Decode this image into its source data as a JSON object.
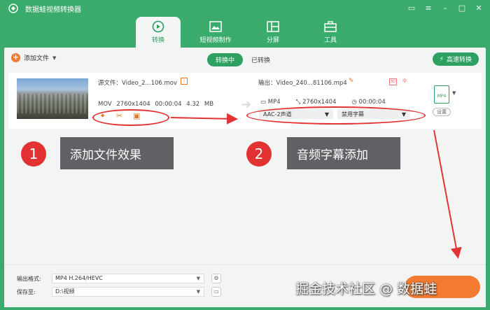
{
  "app": {
    "title": "数据蛙视频转换器",
    "window_controls": [
      "message-icon",
      "menu-icon",
      "minimize-icon",
      "maximize-icon",
      "close-icon"
    ]
  },
  "nav": {
    "tabs": [
      {
        "label": "转换",
        "icon": "convert-icon",
        "active": true
      },
      {
        "label": "短视频制作",
        "icon": "short-video-icon",
        "active": false
      },
      {
        "label": "分屏",
        "icon": "split-screen-icon",
        "active": false
      },
      {
        "label": "工具",
        "icon": "toolbox-icon",
        "active": false
      }
    ]
  },
  "toolbar": {
    "add_file": "添加文件",
    "segment_converting": "转换中",
    "segment_converted": "已转换",
    "fast_convert": "高速转换"
  },
  "file": {
    "source_name": "源文件：Video_2...106.mov",
    "source_meta": "MOV   2760x1404   00:00:04   4.32 MB",
    "output_name": "输出：Video_240...81106.mp4",
    "output_format": "MP4",
    "output_resolution": "2760x1404",
    "output_duration": "00:00:04",
    "audio_select": "AAC-2声道",
    "subtitle_select": "禁用字幕",
    "format_badge": "MP4",
    "settings": "设置"
  },
  "annotations": {
    "n1": "1",
    "label1": "添加文件效果",
    "n2": "2",
    "label2": "音频字幕添加"
  },
  "bottom": {
    "format_label": "输出格式:",
    "format_value": "MP4 H.264/HEVC",
    "save_label": "保存至:",
    "save_value": "D:\\视频"
  },
  "watermark": "掘金技术社区 @ 数据蛙",
  "colors": {
    "brand_green": "#3aab6c",
    "accent_orange": "#f27a31",
    "annotation_red": "#e33232"
  }
}
